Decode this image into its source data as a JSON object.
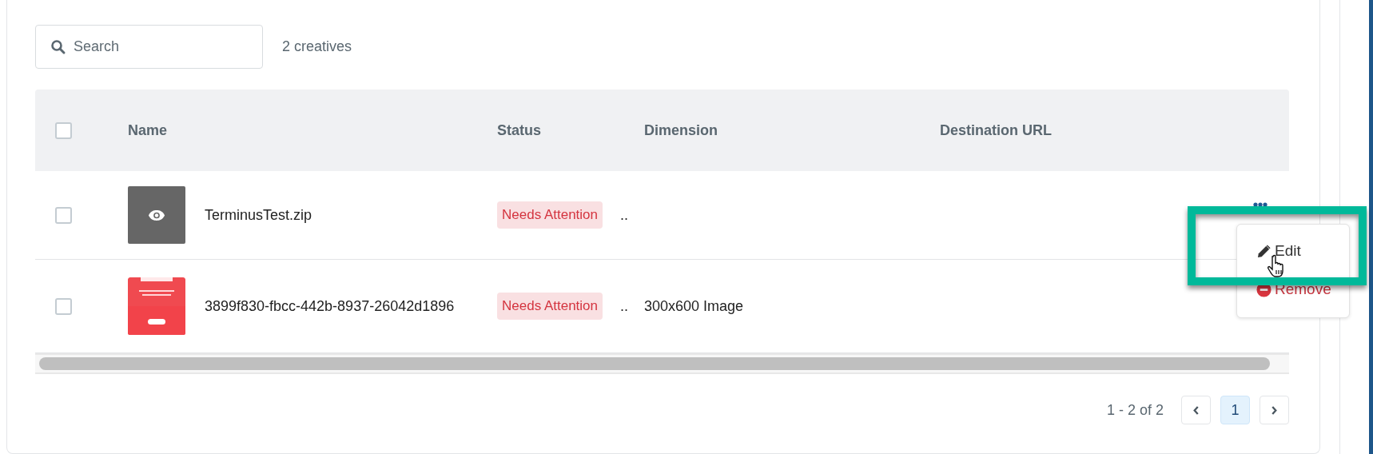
{
  "search": {
    "placeholder": "Search"
  },
  "count": "2 creatives",
  "table": {
    "select_all": {
      "checked": false
    },
    "columns": [
      "Name",
      "Status",
      "Dimension",
      "Destination URL"
    ],
    "rows": [
      {
        "checked": false,
        "thumbnail": {
          "kind": "preview"
        },
        "name": "TerminusTest.zip",
        "status": "Needs Attention",
        "column_3": "..",
        "dimension": "",
        "destination_url": ""
      },
      {
        "checked": false,
        "name": "3899f830-fbcc-442b-8937-26042d1896",
        "status": "Needs Attention",
        "column_3": "..",
        "dimension": "300x600 Image",
        "destination_url": ""
      }
    ]
  },
  "row_menu": {
    "items": [
      {
        "label": "Edit",
        "kind": "edit"
      },
      {
        "label": "Remove",
        "kind": "remove"
      }
    ]
  },
  "pagination": {
    "range": "1 - 2 of 2",
    "pages": [
      {
        "label": "1",
        "selected": true
      }
    ]
  }
}
